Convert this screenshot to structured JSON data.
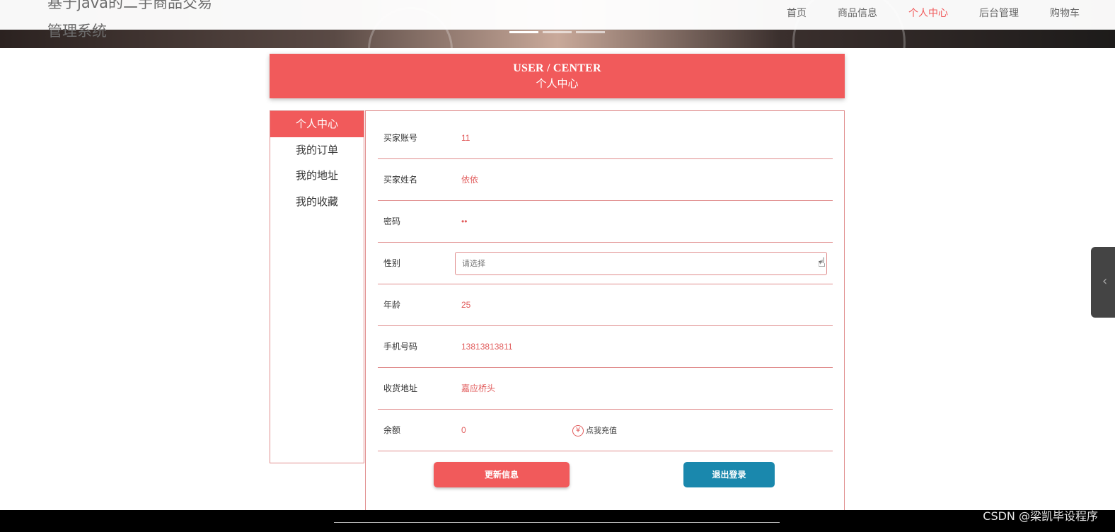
{
  "site": {
    "title": "基于java的二手商品交易管理系统"
  },
  "nav": {
    "items": [
      {
        "label": "首页",
        "active": false
      },
      {
        "label": "商品信息",
        "active": false
      },
      {
        "label": "个人中心",
        "active": true
      },
      {
        "label": "后台管理",
        "active": false
      },
      {
        "label": "购物车",
        "active": false
      }
    ]
  },
  "header": {
    "en": "USER / CENTER",
    "cn": "个人中心"
  },
  "sidebar": {
    "items": [
      {
        "label": "个人中心",
        "active": true
      },
      {
        "label": "我的订单",
        "active": false
      },
      {
        "label": "我的地址",
        "active": false
      },
      {
        "label": "我的收藏",
        "active": false
      }
    ]
  },
  "form": {
    "account": {
      "label": "买家账号",
      "value": "11"
    },
    "name": {
      "label": "买家姓名",
      "value": "依依"
    },
    "password": {
      "label": "密码",
      "value": "••"
    },
    "gender": {
      "label": "性别",
      "placeholder": "请选择"
    },
    "age": {
      "label": "年龄",
      "value": "25"
    },
    "phone": {
      "label": "手机号码",
      "value": "13813813811"
    },
    "address": {
      "label": "收货地址",
      "value": "嘉应桥头"
    },
    "balance": {
      "label": "余额",
      "value": "0",
      "recharge_label": "点我充值",
      "recharge_icon": "¥"
    }
  },
  "buttons": {
    "update_label": "更新信息",
    "logout_label": "退出登录"
  },
  "watermark": "CSDN @梁凯毕设程序",
  "colors": {
    "accent": "#f15a5b",
    "logout": "#1a88ad"
  }
}
